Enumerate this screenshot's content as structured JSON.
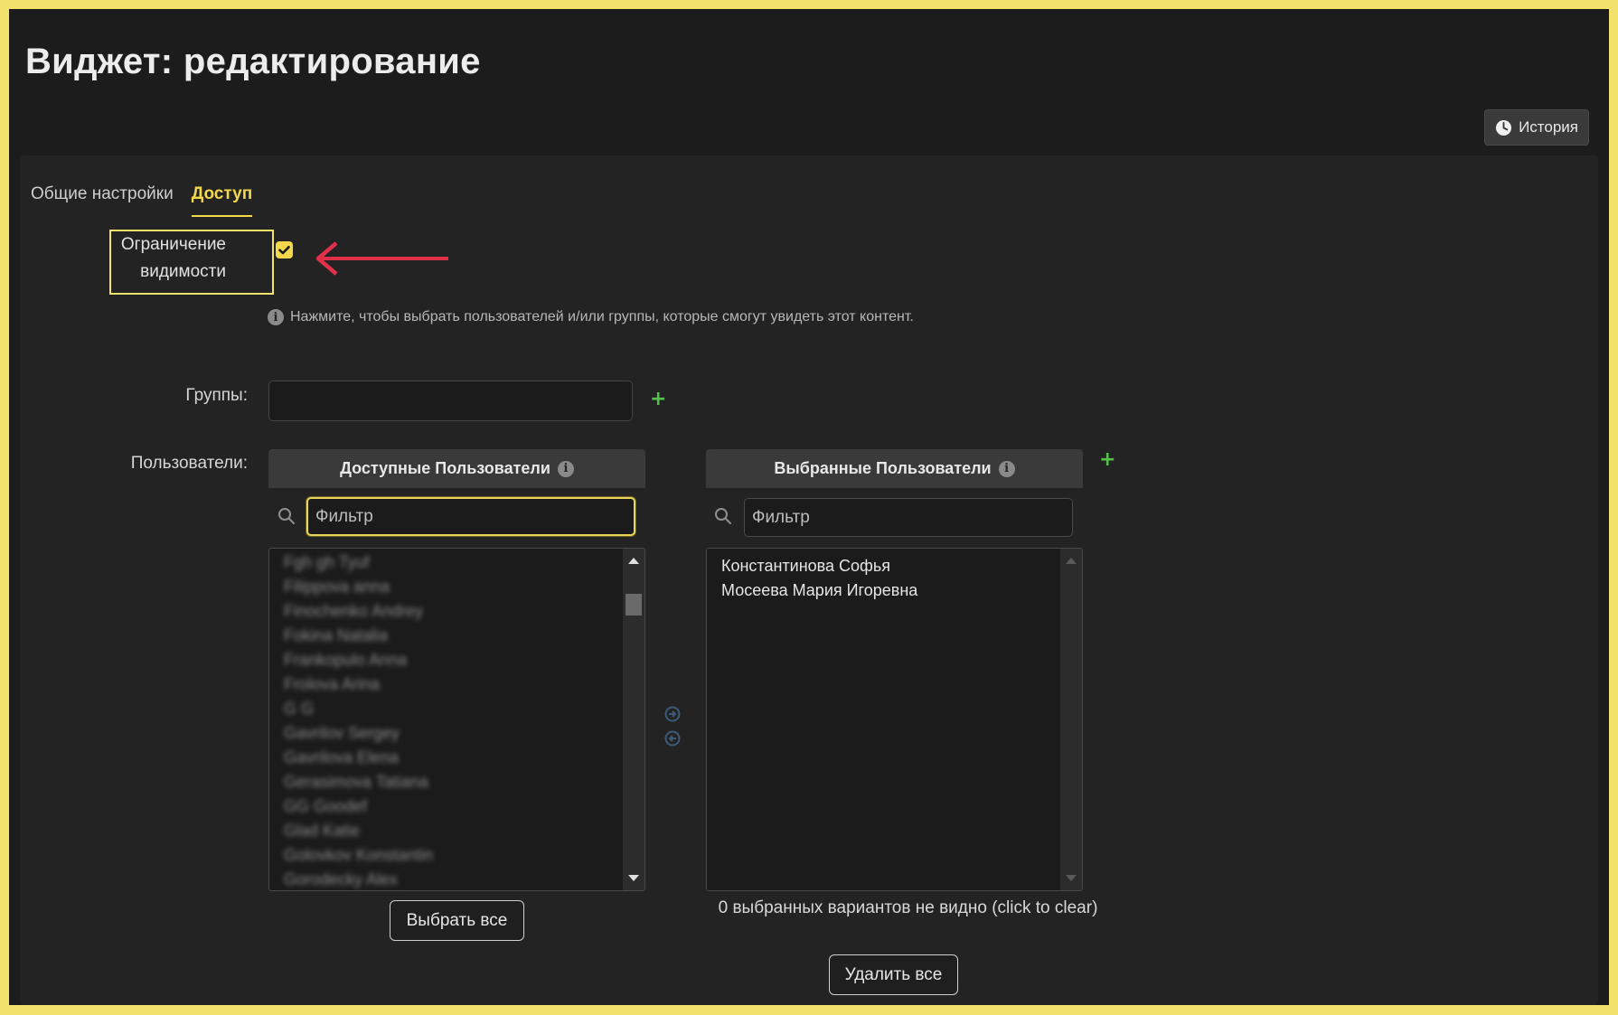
{
  "page": {
    "title": "Виджет: редактирование"
  },
  "toolbar": {
    "history_label": "История",
    "history_icon": "clock-icon"
  },
  "tabs": [
    {
      "label": "Общие настройки",
      "active": false
    },
    {
      "label": "Доступ",
      "active": true
    }
  ],
  "access": {
    "restrict_label": "Ограничение видимости",
    "restrict_checked": true,
    "hint": "Нажмите, чтобы выбрать пользователей и/или группы, которые смогут увидеть этот контент.",
    "groups_label": "Группы:",
    "users_label": "Пользователи:"
  },
  "available": {
    "header": "Доступные Пользователи",
    "filter_placeholder": "Фильтр",
    "items": [
      "Fgh gh Tyuf",
      "Filippova anna",
      "Finochenko Andrey",
      "Fokina Natalia",
      "Frankopulo Anna",
      "Frolova Arina",
      "G G",
      "Gavrilov Sergey",
      "Gavrilova Elena",
      "Gerasimova Tatiana",
      "GG Goodef",
      "Glad Katie",
      "Golovkov Konstantin",
      "Gorodecky Alex"
    ],
    "select_all_label": "Выбрать все"
  },
  "chosen": {
    "header": "Выбранные Пользователи",
    "filter_placeholder": "Фильтр",
    "items": [
      "Константинова Софья",
      "Мосеева Мария Игоревна"
    ],
    "hidden_note": "0 выбранных вариантов не видно (click to clear)",
    "remove_all_label": "Удалить все"
  },
  "colors": {
    "accent": "#f2d84a",
    "frame": "#f2e16a",
    "annotation_arrow": "#e0304a",
    "add": "#54c24a"
  }
}
